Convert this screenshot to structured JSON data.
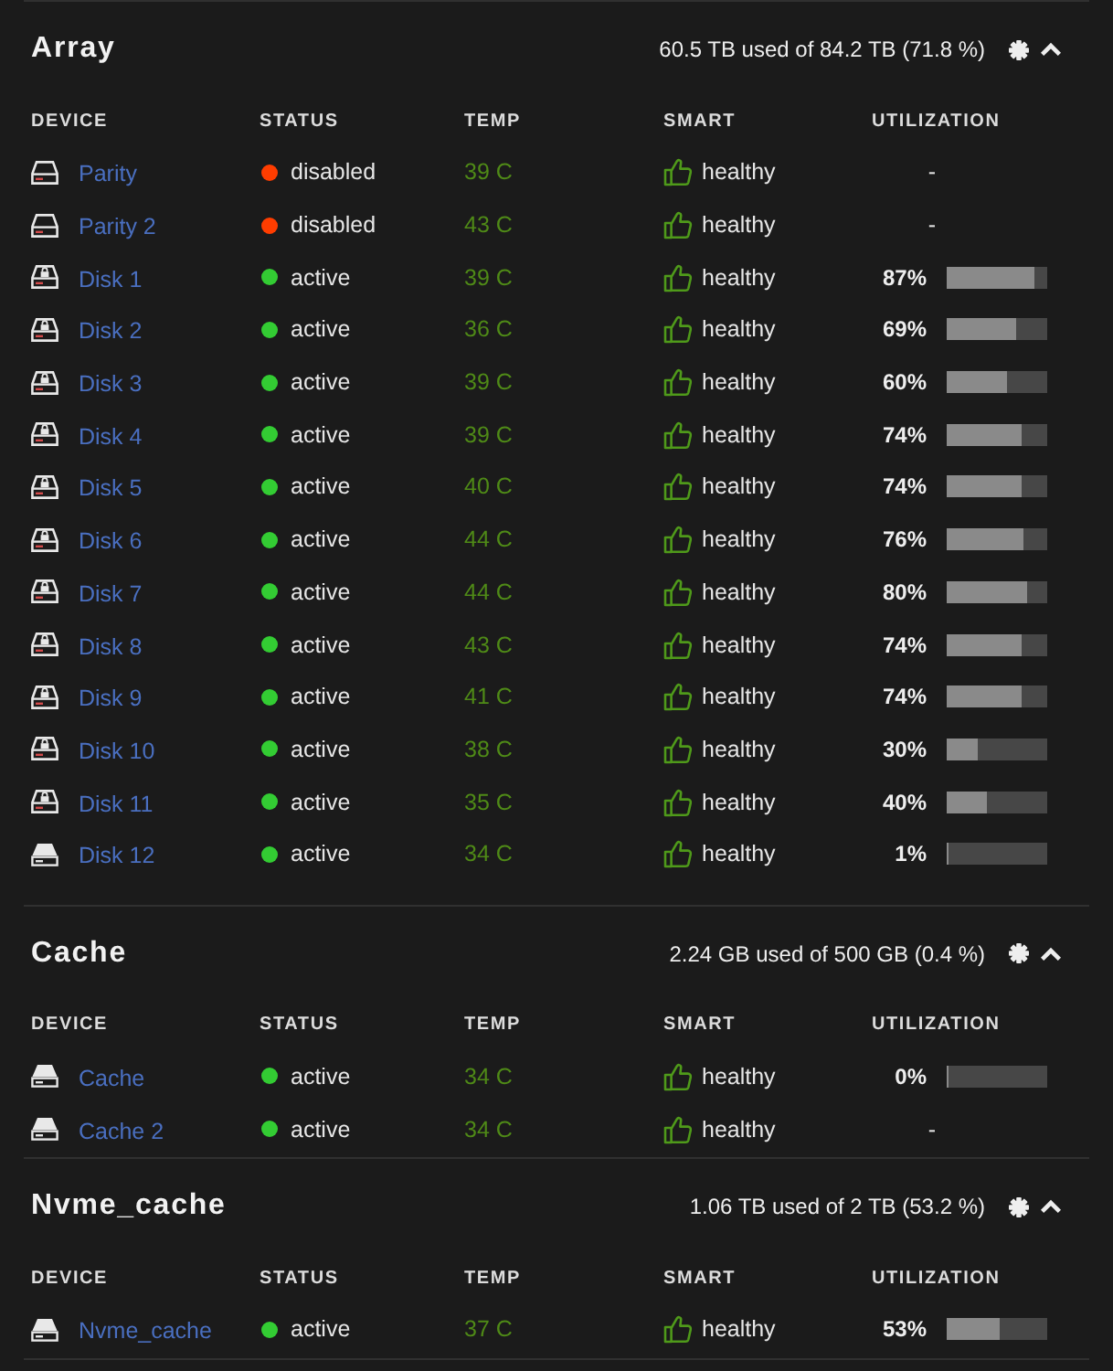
{
  "sections": [
    {
      "title": "Array",
      "summary": "60.5 TB used of 84.2 TB (71.8 %)",
      "expanded": true,
      "columns": [
        "DEVICE",
        "STATUS",
        "TEMP",
        "SMART",
        "UTILIZATION"
      ],
      "rows": [
        {
          "kind": "hdd",
          "name": "Parity",
          "status": {
            "label": "disabled",
            "color": "#ff3d00"
          },
          "temp": "39 C",
          "smart": "healthy",
          "utilization": {
            "reading": "-"
          }
        },
        {
          "kind": "hdd",
          "name": "Parity 2",
          "status": {
            "label": "disabled",
            "color": "#ff3d00"
          },
          "temp": "43 C",
          "smart": "healthy",
          "utilization": {
            "reading": "-"
          }
        },
        {
          "kind": "locked",
          "name": "Disk 1",
          "status": {
            "label": "active",
            "color": "#33cc33"
          },
          "temp": "39 C",
          "smart": "healthy",
          "utilization": {
            "reading": "87%",
            "level": 0.87
          }
        },
        {
          "kind": "locked",
          "name": "Disk 2",
          "status": {
            "label": "active",
            "color": "#33cc33"
          },
          "temp": "36 C",
          "smart": "healthy",
          "utilization": {
            "reading": "69%",
            "level": 0.69
          }
        },
        {
          "kind": "locked",
          "name": "Disk 3",
          "status": {
            "label": "active",
            "color": "#33cc33"
          },
          "temp": "39 C",
          "smart": "healthy",
          "utilization": {
            "reading": "60%",
            "level": 0.6
          }
        },
        {
          "kind": "locked",
          "name": "Disk 4",
          "status": {
            "label": "active",
            "color": "#33cc33"
          },
          "temp": "39 C",
          "smart": "healthy",
          "utilization": {
            "reading": "74%",
            "level": 0.74
          }
        },
        {
          "kind": "locked",
          "name": "Disk 5",
          "status": {
            "label": "active",
            "color": "#33cc33"
          },
          "temp": "40 C",
          "smart": "healthy",
          "utilization": {
            "reading": "74%",
            "level": 0.74
          }
        },
        {
          "kind": "locked",
          "name": "Disk 6",
          "status": {
            "label": "active",
            "color": "#33cc33"
          },
          "temp": "44 C",
          "smart": "healthy",
          "utilization": {
            "reading": "76%",
            "level": 0.76
          }
        },
        {
          "kind": "locked",
          "name": "Disk 7",
          "status": {
            "label": "active",
            "color": "#33cc33"
          },
          "temp": "44 C",
          "smart": "healthy",
          "utilization": {
            "reading": "80%",
            "level": 0.8
          }
        },
        {
          "kind": "locked",
          "name": "Disk 8",
          "status": {
            "label": "active",
            "color": "#33cc33"
          },
          "temp": "43 C",
          "smart": "healthy",
          "utilization": {
            "reading": "74%",
            "level": 0.74
          }
        },
        {
          "kind": "locked",
          "name": "Disk 9",
          "status": {
            "label": "active",
            "color": "#33cc33"
          },
          "temp": "41 C",
          "smart": "healthy",
          "utilization": {
            "reading": "74%",
            "level": 0.74
          }
        },
        {
          "kind": "locked",
          "name": "Disk 10",
          "status": {
            "label": "active",
            "color": "#33cc33"
          },
          "temp": "38 C",
          "smart": "healthy",
          "utilization": {
            "reading": "30%",
            "level": 0.3
          }
        },
        {
          "kind": "locked",
          "name": "Disk 11",
          "status": {
            "label": "active",
            "color": "#33cc33"
          },
          "temp": "35 C",
          "smart": "healthy",
          "utilization": {
            "reading": "40%",
            "level": 0.4
          }
        },
        {
          "kind": "ssd",
          "name": "Disk 12",
          "status": {
            "label": "active",
            "color": "#33cc33"
          },
          "temp": "34 C",
          "smart": "healthy",
          "utilization": {
            "reading": "1%",
            "level": 0.01
          }
        }
      ]
    },
    {
      "title": "Cache",
      "summary": "2.24 GB used of 500 GB (0.4 %)",
      "expanded": true,
      "columns": [
        "DEVICE",
        "STATUS",
        "TEMP",
        "SMART",
        "UTILIZATION"
      ],
      "rows": [
        {
          "kind": "ssd",
          "name": "Cache",
          "status": {
            "label": "active",
            "color": "#33cc33"
          },
          "temp": "34 C",
          "smart": "healthy",
          "utilization": {
            "reading": "0%",
            "level": 0
          }
        },
        {
          "kind": "ssd",
          "name": "Cache 2",
          "status": {
            "label": "active",
            "color": "#33cc33"
          },
          "temp": "34 C",
          "smart": "healthy",
          "utilization": {
            "reading": "-"
          }
        }
      ]
    },
    {
      "title": "Nvme_cache",
      "summary": "1.06 TB used of 2 TB (53.2 %)",
      "expanded": true,
      "columns": [
        "DEVICE",
        "STATUS",
        "TEMP",
        "SMART",
        "UTILIZATION"
      ],
      "rows": [
        {
          "kind": "ssd",
          "name": "Nvme_cache",
          "status": {
            "label": "active",
            "color": "#33cc33"
          },
          "temp": "37 C",
          "smart": "healthy",
          "utilization": {
            "reading": "53%",
            "level": 0.53
          }
        }
      ]
    }
  ]
}
